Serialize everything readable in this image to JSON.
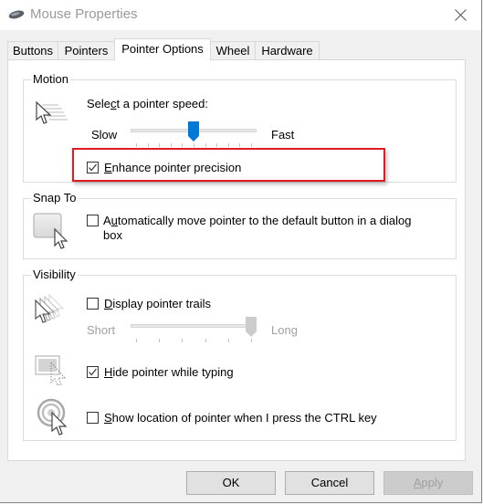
{
  "window": {
    "title": "Mouse Properties",
    "close_icon": "close-icon",
    "app_icon": "mouse-icon"
  },
  "tabs": [
    {
      "label": "Buttons",
      "selected": false
    },
    {
      "label": "Pointers",
      "selected": false
    },
    {
      "label": "Pointer Options",
      "selected": true
    },
    {
      "label": "Wheel",
      "selected": false
    },
    {
      "label": "Hardware",
      "selected": false
    }
  ],
  "motion": {
    "group_label": "Motion",
    "icon": "pointer-speed-icon",
    "speed_label_pre": "Sele",
    "speed_label_accel": "c",
    "speed_label_post": "t a pointer speed:",
    "slow_label": "Slow",
    "fast_label": "Fast",
    "speed_value": 5,
    "speed_max": 10,
    "enhance_precision": {
      "accel": "E",
      "label_rest": "nhance pointer precision",
      "checked": true,
      "highlighted": true,
      "highlight_color": "#e21b23"
    }
  },
  "snap_to": {
    "group_label": "Snap To",
    "icon": "snap-to-button-icon",
    "option": {
      "pre": "A",
      "accel": "u",
      "rest_line1": "tomatically move pointer to the default button in a dialog",
      "rest_line2": "box",
      "checked": false
    }
  },
  "visibility": {
    "group_label": "Visibility",
    "trails": {
      "icon": "pointer-trails-icon",
      "accel": "D",
      "label_rest": "isplay pointer trails",
      "checked": false,
      "short_label": "Short",
      "long_label": "Long",
      "length_value": 5,
      "length_max": 5,
      "enabled": false
    },
    "hide_typing": {
      "icon": "hide-pointer-icon",
      "accel": "H",
      "label_rest": "ide pointer while typing",
      "checked": true
    },
    "show_location": {
      "icon": "pointer-location-icon",
      "accel": "S",
      "label_rest": "how location of pointer when I press the CTRL key",
      "checked": false
    }
  },
  "buttons": {
    "ok": "OK",
    "cancel": "Cancel",
    "apply_accel": "A",
    "apply_rest": "pply",
    "apply_enabled": false
  },
  "colors": {
    "accent": "#0078d7",
    "highlight": "#e21b23",
    "disabled_text": "#a0a0a0"
  }
}
